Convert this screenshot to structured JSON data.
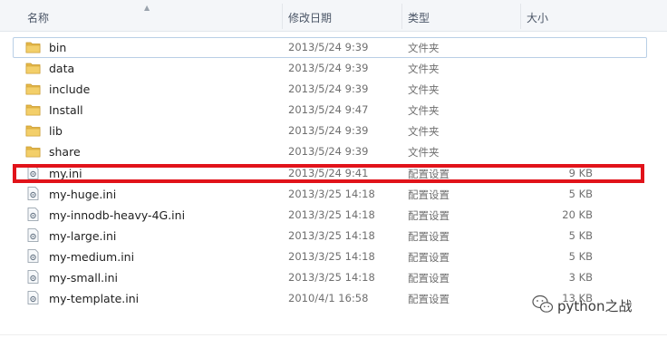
{
  "columns": {
    "name": "名称",
    "modified": "修改日期",
    "type": "类型",
    "size": "大小"
  },
  "files": [
    {
      "name": "bin",
      "date": "2013/5/24 9:39",
      "type": "文件夹",
      "size": "",
      "icon": "folder-icon"
    },
    {
      "name": "data",
      "date": "2013/5/24 9:39",
      "type": "文件夹",
      "size": "",
      "icon": "folder-icon"
    },
    {
      "name": "include",
      "date": "2013/5/24 9:39",
      "type": "文件夹",
      "size": "",
      "icon": "folder-icon"
    },
    {
      "name": "Install",
      "date": "2013/5/24 9:47",
      "type": "文件夹",
      "size": "",
      "icon": "folder-icon"
    },
    {
      "name": "lib",
      "date": "2013/5/24 9:39",
      "type": "文件夹",
      "size": "",
      "icon": "folder-icon"
    },
    {
      "name": "share",
      "date": "2013/5/24 9:39",
      "type": "文件夹",
      "size": "",
      "icon": "folder-icon"
    },
    {
      "name": "my.ini",
      "date": "2013/5/24 9:41",
      "type": "配置设置",
      "size": "9 KB",
      "icon": "config-file-icon"
    },
    {
      "name": "my-huge.ini",
      "date": "2013/3/25 14:18",
      "type": "配置设置",
      "size": "5 KB",
      "icon": "config-file-icon"
    },
    {
      "name": "my-innodb-heavy-4G.ini",
      "date": "2013/3/25 14:18",
      "type": "配置设置",
      "size": "20 KB",
      "icon": "config-file-icon"
    },
    {
      "name": "my-large.ini",
      "date": "2013/3/25 14:18",
      "type": "配置设置",
      "size": "5 KB",
      "icon": "config-file-icon"
    },
    {
      "name": "my-medium.ini",
      "date": "2013/3/25 14:18",
      "type": "配置设置",
      "size": "5 KB",
      "icon": "config-file-icon"
    },
    {
      "name": "my-small.ini",
      "date": "2013/3/25 14:18",
      "type": "配置设置",
      "size": "3 KB",
      "icon": "config-file-icon"
    },
    {
      "name": "my-template.ini",
      "date": "2010/4/1 16:58",
      "type": "配置设置",
      "size": "13 KB",
      "icon": "config-file-icon"
    }
  ],
  "focused_index": 0,
  "highlighted_file": "my.ini",
  "highlight_color": "#e1131a",
  "folder_color": "#e6b94a",
  "watermark": {
    "text": "python之战",
    "icon": "wechat-icon"
  }
}
